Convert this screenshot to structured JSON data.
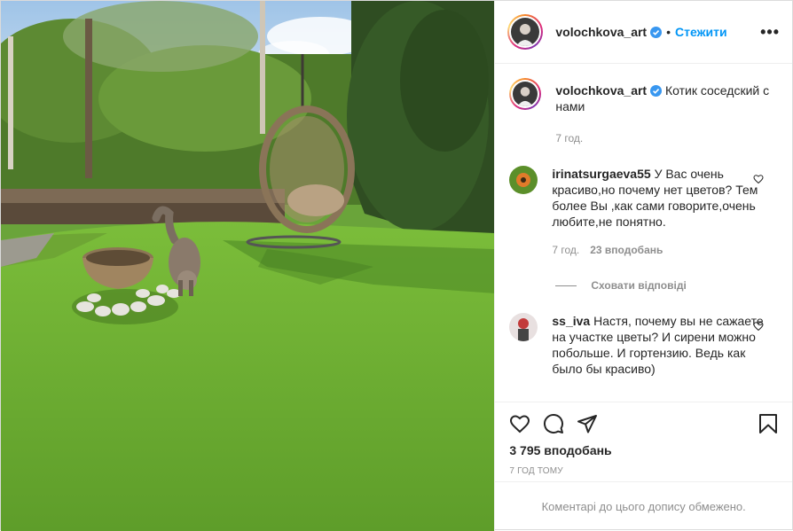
{
  "post": {
    "author": {
      "username": "volochkova_art",
      "verified": true,
      "follow_label": "Стежити",
      "more_label": "•••"
    },
    "caption": {
      "username": "volochkova_art",
      "text": "Котик соседский с нами",
      "time": "7 год."
    },
    "comments": [
      {
        "username": "irinatsurgaeva55",
        "text": "У Вас очень красиво,но почему нет цветов? Тем более Вы ,как сами говорите,очень любите,не понятно.",
        "time": "7 год.",
        "likes": "23 вподобань",
        "replies_toggle": "Сховати відповіді"
      },
      {
        "username": "ss_iva",
        "text": "Настя, почему вы не сажаете на участке цветы? И сирени можно побольше. И гортензию. Ведь как было бы красиво)"
      }
    ],
    "likes_count": "3 795 вподобань",
    "posted_ago": "7 ГОД ТОМУ",
    "comments_restricted": "Коментарі до цього допису обмежено."
  },
  "colors": {
    "accent": "#0095f6",
    "muted": "#8e8e8e",
    "text": "#262626"
  },
  "icons": [
    "verified-badge-icon",
    "heart-icon",
    "comment-icon",
    "share-icon",
    "bookmark-icon",
    "more-icon"
  ]
}
